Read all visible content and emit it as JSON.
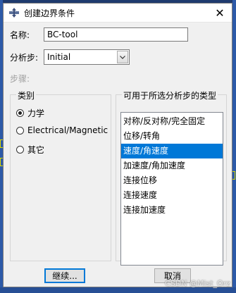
{
  "window": {
    "title": "创建边界条件",
    "close_glyph": "✕"
  },
  "form": {
    "name_label": "名称:",
    "name_value": "BC-tool",
    "step_label": "分析步:",
    "step_value": "Initial",
    "procedure_label": "步骤:"
  },
  "category": {
    "title": "类别",
    "options": [
      {
        "label": "力学",
        "selected": true
      },
      {
        "label": "Electrical/Magnetic",
        "selected": false
      },
      {
        "label": "其它",
        "selected": false
      }
    ]
  },
  "types": {
    "title": "可用于所选分析步的类型",
    "items": [
      "对称/反对称/完全固定",
      "位移/转角",
      "速度/角速度",
      "加速度/角加速度",
      "连接位移",
      "连接速度",
      "连接加速度"
    ],
    "selected_index": 2
  },
  "buttons": {
    "continue": "继续...",
    "cancel": "取消"
  },
  "watermark": "CSDN @Mist_Orz",
  "colors": {
    "selection": "#0078d7",
    "dialog_bg": "#f0f0f0",
    "canvas": "#1f3b6e"
  },
  "icons": {
    "title": "boundary-condition-icon",
    "close": "close-icon",
    "dropdown": "chevron-down-icon"
  }
}
